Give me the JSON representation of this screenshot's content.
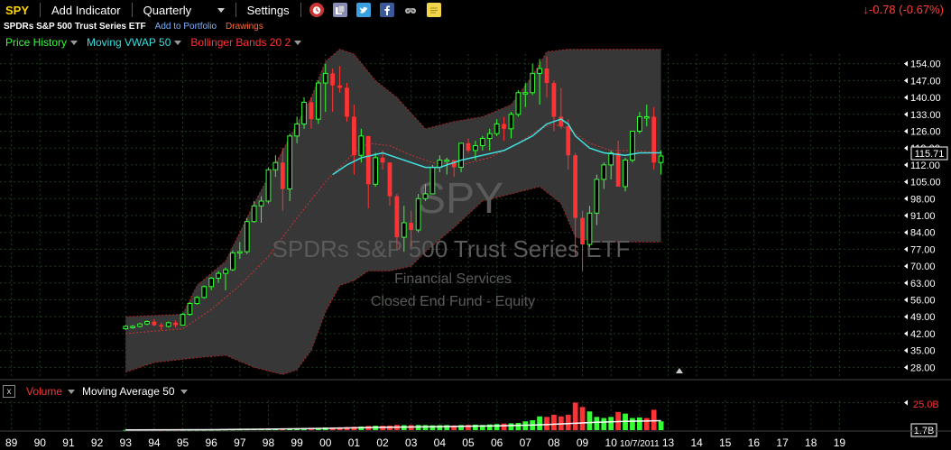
{
  "toolbar": {
    "ticker": "SPY",
    "add_indicator": "Add Indicator",
    "period": "Quarterly",
    "settings": "Settings",
    "change": "-0.78 (-0.67%)",
    "icons": [
      "alarm-icon",
      "copy-icon",
      "twitter-icon",
      "facebook-icon",
      "binoculars-icon",
      "notes-icon"
    ]
  },
  "subline": {
    "name": "SPDRs S&P 500 Trust Series ETF",
    "add_portfolio": "Add to Portfolio",
    "drawings": "Drawings"
  },
  "indicators": [
    {
      "label": "Price History",
      "color": "#33ff33"
    },
    {
      "label": "Moving VWAP 50",
      "color": "#33e0e0"
    },
    {
      "label": "Bollinger Bands 20 2",
      "color": "#ff3333"
    }
  ],
  "watermark": {
    "ticker": "SPY",
    "name": "SPDRs S&P 500 Trust Series ETF",
    "sector": "Financial Services",
    "type": "Closed End Fund - Equity"
  },
  "volume_panel": {
    "close": "x",
    "label": "Volume",
    "ma_label": "Moving Average 50",
    "yticks": [
      "25.0B"
    ],
    "last_label": "1.7B"
  },
  "colors": {
    "up": "#33ff33",
    "down": "#ff3333",
    "vwap": "#40e0e0",
    "band_fill": "#3a3a3a",
    "change": "#ff3b3b"
  },
  "chart_data": {
    "type": "candlestick",
    "period": "Quarterly",
    "price_axis": {
      "ticks": [
        28,
        35,
        42,
        49,
        56,
        63,
        70,
        77,
        84,
        91,
        98,
        105,
        112,
        119,
        126,
        133,
        140,
        147,
        154
      ],
      "ylim": [
        24,
        158
      ],
      "last_price": "115.71"
    },
    "x_axis": {
      "tick_labels": [
        "89",
        "90",
        "91",
        "92",
        "93",
        "94",
        "95",
        "96",
        "97",
        "98",
        "99",
        "00",
        "01",
        "02",
        "03",
        "04",
        "05",
        "06",
        "07",
        "08",
        "09",
        "10",
        "10/7/2011",
        "13",
        "14",
        "15",
        "16",
        "17",
        "18",
        "19"
      ],
      "xlim": [
        1988.6,
        2020.2
      ]
    },
    "candles": [
      [
        1993.0,
        44.0,
        45.5,
        43.5,
        45.0
      ],
      [
        1993.25,
        45.0,
        45.5,
        44.0,
        45.0
      ],
      [
        1993.5,
        45.0,
        46.5,
        44.5,
        46.0
      ],
      [
        1993.75,
        46.0,
        47.5,
        45.5,
        47.0
      ],
      [
        1994.0,
        47.0,
        48.0,
        45.0,
        45.5
      ],
      [
        1994.25,
        45.5,
        46.5,
        43.5,
        45.0
      ],
      [
        1994.5,
        45.0,
        47.0,
        44.5,
        46.5
      ],
      [
        1994.75,
        46.5,
        47.5,
        44.5,
        45.5
      ],
      [
        1995.0,
        45.5,
        50.5,
        45.5,
        50.0
      ],
      [
        1995.25,
        50.0,
        55.0,
        49.5,
        54.5
      ],
      [
        1995.5,
        54.5,
        57.5,
        54.0,
        57.0
      ],
      [
        1995.75,
        57.0,
        62.0,
        56.5,
        61.5
      ],
      [
        1996.0,
        61.5,
        65.5,
        60.0,
        65.0
      ],
      [
        1996.25,
        65.0,
        68.0,
        63.0,
        67.0
      ],
      [
        1996.5,
        67.0,
        69.5,
        60.0,
        68.5
      ],
      [
        1996.75,
        68.5,
        76.5,
        68.0,
        75.5
      ],
      [
        1997.0,
        75.5,
        80.0,
        73.0,
        76.0
      ],
      [
        1997.25,
        76.0,
        90.0,
        75.0,
        88.5
      ],
      [
        1997.5,
        88.5,
        97.0,
        88.0,
        95.0
      ],
      [
        1997.75,
        95.0,
        99.0,
        88.0,
        97.0
      ],
      [
        1998.0,
        97.0,
        111.0,
        96.0,
        110.0
      ],
      [
        1998.25,
        110.0,
        116.0,
        107.0,
        113.0
      ],
      [
        1998.5,
        113.0,
        119.0,
        93.0,
        102.0
      ],
      [
        1998.75,
        102.0,
        125.0,
        97.0,
        124.0
      ],
      [
        1999.0,
        124.0,
        132.0,
        121.0,
        129.0
      ],
      [
        1999.25,
        129.0,
        140.0,
        127.0,
        138.0
      ],
      [
        1999.5,
        138.0,
        140.0,
        127.0,
        131.0
      ],
      [
        1999.75,
        131.0,
        147.0,
        129.0,
        146.0
      ],
      [
        2000.0,
        146.0,
        154.0,
        134.0,
        150.0
      ],
      [
        2000.25,
        150.0,
        152.0,
        134.0,
        145.0
      ],
      [
        2000.5,
        145.0,
        153.0,
        142.0,
        144.0
      ],
      [
        2000.75,
        144.0,
        146.0,
        130.0,
        132.0
      ],
      [
        2001.0,
        132.0,
        137.0,
        108.0,
        116.0
      ],
      [
        2001.25,
        116.0,
        127.0,
        113.0,
        124.0
      ],
      [
        2001.5,
        124.0,
        124.0,
        94.0,
        104.0
      ],
      [
        2001.75,
        104.0,
        117.0,
        103.0,
        115.0
      ],
      [
        2002.0,
        115.0,
        118.0,
        110.0,
        113.0
      ],
      [
        2002.25,
        113.0,
        113.0,
        95.0,
        99.0
      ],
      [
        2002.5,
        99.0,
        100.0,
        77.0,
        82.0
      ],
      [
        2002.75,
        82.0,
        95.0,
        76.0,
        88.0
      ],
      [
        2003.0,
        88.0,
        93.0,
        78.0,
        85.0
      ],
      [
        2003.25,
        85.0,
        100.0,
        84.0,
        98.0
      ],
      [
        2003.5,
        98.0,
        104.0,
        97.0,
        100.0
      ],
      [
        2003.75,
        100.0,
        112.0,
        100.0,
        111.0
      ],
      [
        2004.0,
        111.0,
        116.0,
        109.0,
        114.0
      ],
      [
        2004.25,
        114.0,
        115.0,
        108.0,
        114.0
      ],
      [
        2004.5,
        114.0,
        114.0,
        107.0,
        111.0
      ],
      [
        2004.75,
        111.0,
        121.0,
        109.0,
        121.0
      ],
      [
        2005.0,
        121.0,
        123.0,
        117.0,
        118.0
      ],
      [
        2005.25,
        118.0,
        122.0,
        114.0,
        120.0
      ],
      [
        2005.5,
        120.0,
        124.0,
        118.0,
        123.0
      ],
      [
        2005.75,
        123.0,
        127.0,
        118.0,
        125.0
      ],
      [
        2006.0,
        125.0,
        131.0,
        124.0,
        129.0
      ],
      [
        2006.25,
        129.0,
        132.0,
        122.0,
        127.0
      ],
      [
        2006.5,
        127.0,
        134.0,
        123.0,
        133.0
      ],
      [
        2006.75,
        133.0,
        143.0,
        132.0,
        142.0
      ],
      [
        2007.0,
        142.0,
        146.0,
        136.0,
        142.0
      ],
      [
        2007.25,
        142.0,
        154.0,
        141.0,
        150.0
      ],
      [
        2007.5,
        150.0,
        156.0,
        137.0,
        152.0
      ],
      [
        2007.75,
        152.0,
        157.0,
        140.0,
        146.0
      ],
      [
        2008.0,
        146.0,
        147.0,
        126.0,
        132.0
      ],
      [
        2008.25,
        132.0,
        144.0,
        127.0,
        128.0
      ],
      [
        2008.5,
        128.0,
        131.0,
        110.0,
        116.0
      ],
      [
        2008.75,
        116.0,
        117.0,
        74.0,
        90.0
      ],
      [
        2009.0,
        90.0,
        93.0,
        68.0,
        79.0
      ],
      [
        2009.25,
        79.0,
        95.0,
        78.0,
        92.0
      ],
      [
        2009.5,
        92.0,
        108.0,
        87.0,
        106.0
      ],
      [
        2009.75,
        106.0,
        113.0,
        102.0,
        112.0
      ],
      [
        2010.0,
        112.0,
        118.0,
        106.0,
        117.0
      ],
      [
        2010.25,
        117.0,
        122.0,
        103.0,
        103.0
      ],
      [
        2010.5,
        103.0,
        115.0,
        101.0,
        114.0
      ],
      [
        2010.75,
        114.0,
        126.0,
        113.0,
        126.0
      ],
      [
        2011.0,
        126.0,
        134.0,
        125.0,
        132.0
      ],
      [
        2011.25,
        132.0,
        137.0,
        128.0,
        132.0
      ],
      [
        2011.5,
        132.0,
        136.0,
        110.0,
        113.0
      ],
      [
        2011.75,
        113.0,
        118.0,
        108.0,
        115.7
      ]
    ],
    "bollinger": {
      "upper": [
        [
          1993.0,
          49
        ],
        [
          1995.0,
          50
        ],
        [
          1995.5,
          62
        ],
        [
          1996.5,
          72
        ],
        [
          1997.5,
          96
        ],
        [
          1998.5,
          118
        ],
        [
          1999.5,
          140
        ],
        [
          2000.0,
          155
        ],
        [
          2000.5,
          160
        ],
        [
          2001.0,
          158
        ],
        [
          2001.75,
          147
        ],
        [
          2002.5,
          140
        ],
        [
          2003.5,
          127
        ],
        [
          2004.5,
          130
        ],
        [
          2005.5,
          132
        ],
        [
          2006.5,
          137
        ],
        [
          2007.25,
          149
        ],
        [
          2007.75,
          159
        ],
        [
          2008.5,
          160
        ],
        [
          2009.5,
          160
        ],
        [
          2010.5,
          160
        ],
        [
          2011.75,
          160
        ]
      ],
      "middle": [
        [
          1993.0,
          42
        ],
        [
          1995.0,
          44
        ],
        [
          1996.0,
          52
        ],
        [
          1997.0,
          62
        ],
        [
          1998.0,
          74
        ],
        [
          1999.0,
          90
        ],
        [
          2000.0,
          105
        ],
        [
          2001.0,
          117
        ],
        [
          2001.5,
          121
        ],
        [
          2002.25,
          120
        ],
        [
          2003.0,
          116
        ],
        [
          2003.75,
          113
        ],
        [
          2004.75,
          112
        ],
        [
          2005.75,
          115
        ],
        [
          2006.75,
          121
        ],
        [
          2007.5,
          127
        ],
        [
          2008.0,
          129
        ],
        [
          2008.5,
          127
        ],
        [
          2009.25,
          121
        ],
        [
          2010.0,
          118
        ],
        [
          2010.75,
          118
        ],
        [
          2011.75,
          117
        ]
      ],
      "lower": [
        [
          1993.0,
          26
        ],
        [
          1994.0,
          30
        ],
        [
          1995.5,
          32
        ],
        [
          1996.5,
          33
        ],
        [
          1997.5,
          28
        ],
        [
          1998.5,
          25
        ],
        [
          1999.0,
          27
        ],
        [
          1999.5,
          35
        ],
        [
          2000.0,
          51
        ],
        [
          2000.5,
          62
        ],
        [
          2001.0,
          64
        ],
        [
          2001.5,
          68
        ],
        [
          2002.25,
          68
        ],
        [
          2003.0,
          70
        ],
        [
          2003.5,
          76
        ],
        [
          2004.5,
          86
        ],
        [
          2005.5,
          97
        ],
        [
          2006.5,
          100
        ],
        [
          2007.5,
          103
        ],
        [
          2008.25,
          96
        ],
        [
          2008.75,
          82
        ],
        [
          2009.5,
          80
        ],
        [
          2010.5,
          80
        ],
        [
          2011.75,
          80
        ]
      ]
    },
    "vwap": [
      [
        2000.25,
        108
      ],
      [
        2000.75,
        112
      ],
      [
        2001.25,
        115
      ],
      [
        2002.0,
        117
      ],
      [
        2002.75,
        114
      ],
      [
        2003.5,
        111
      ],
      [
        2004.0,
        111
      ],
      [
        2004.75,
        114
      ],
      [
        2005.5,
        116
      ],
      [
        2006.25,
        118
      ],
      [
        2006.75,
        121
      ],
      [
        2007.25,
        124
      ],
      [
        2007.75,
        129
      ],
      [
        2008.25,
        131
      ],
      [
        2008.5,
        129
      ],
      [
        2008.75,
        124
      ],
      [
        2009.25,
        119
      ],
      [
        2009.75,
        117
      ],
      [
        2010.5,
        116
      ],
      [
        2011.0,
        117
      ],
      [
        2011.75,
        117
      ]
    ],
    "volume": [
      [
        1993.0,
        0.2,
        1
      ],
      [
        1993.25,
        0.2,
        0
      ],
      [
        1993.5,
        0.2,
        1
      ],
      [
        1993.75,
        0.2,
        1
      ],
      [
        1994.0,
        0.3,
        0
      ],
      [
        1994.25,
        0.3,
        0
      ],
      [
        1994.5,
        0.3,
        1
      ],
      [
        1994.75,
        0.3,
        0
      ],
      [
        1995.0,
        0.3,
        1
      ],
      [
        1995.25,
        0.3,
        1
      ],
      [
        1995.5,
        0.3,
        1
      ],
      [
        1995.75,
        0.4,
        1
      ],
      [
        1996.0,
        0.5,
        1
      ],
      [
        1996.25,
        0.5,
        1
      ],
      [
        1996.5,
        0.6,
        1
      ],
      [
        1996.75,
        0.6,
        1
      ],
      [
        1997.0,
        0.7,
        1
      ],
      [
        1997.25,
        0.8,
        1
      ],
      [
        1997.5,
        0.9,
        1
      ],
      [
        1997.75,
        1.0,
        1
      ],
      [
        1998.0,
        1.2,
        1
      ],
      [
        1998.25,
        1.3,
        1
      ],
      [
        1998.5,
        1.5,
        0
      ],
      [
        1998.75,
        1.5,
        1
      ],
      [
        1999.0,
        1.6,
        1
      ],
      [
        1999.25,
        1.8,
        1
      ],
      [
        1999.5,
        2.0,
        0
      ],
      [
        1999.75,
        2.1,
        1
      ],
      [
        2000.0,
        2.4,
        1
      ],
      [
        2000.25,
        2.5,
        0
      ],
      [
        2000.5,
        2.6,
        0
      ],
      [
        2000.75,
        2.8,
        0
      ],
      [
        2001.0,
        3.1,
        0
      ],
      [
        2001.25,
        3.3,
        1
      ],
      [
        2001.5,
        3.8,
        0
      ],
      [
        2001.75,
        4.0,
        1
      ],
      [
        2002.0,
        4.0,
        0
      ],
      [
        2002.25,
        4.2,
        0
      ],
      [
        2002.5,
        4.8,
        0
      ],
      [
        2002.75,
        4.5,
        1
      ],
      [
        2003.0,
        4.6,
        0
      ],
      [
        2003.25,
        4.7,
        1
      ],
      [
        2003.5,
        4.6,
        1
      ],
      [
        2003.75,
        4.4,
        1
      ],
      [
        2004.0,
        4.5,
        1
      ],
      [
        2004.25,
        4.6,
        1
      ],
      [
        2004.5,
        4.3,
        0
      ],
      [
        2004.75,
        4.6,
        1
      ],
      [
        2005.0,
        4.8,
        0
      ],
      [
        2005.25,
        5.0,
        1
      ],
      [
        2005.5,
        4.7,
        1
      ],
      [
        2005.75,
        5.2,
        1
      ],
      [
        2006.0,
        5.5,
        1
      ],
      [
        2006.25,
        6.0,
        0
      ],
      [
        2006.5,
        6.2,
        1
      ],
      [
        2006.75,
        6.5,
        1
      ],
      [
        2007.0,
        8.0,
        1
      ],
      [
        2007.25,
        9.0,
        1
      ],
      [
        2007.5,
        12.5,
        1
      ],
      [
        2007.75,
        12.0,
        0
      ],
      [
        2008.0,
        14.0,
        0
      ],
      [
        2008.25,
        12.5,
        0
      ],
      [
        2008.5,
        14.0,
        0
      ],
      [
        2008.75,
        25.0,
        0
      ],
      [
        2009.0,
        21.0,
        0
      ],
      [
        2009.25,
        17.0,
        1
      ],
      [
        2009.5,
        12.0,
        1
      ],
      [
        2009.75,
        11.0,
        1
      ],
      [
        2010.0,
        12.0,
        1
      ],
      [
        2010.25,
        16.5,
        0
      ],
      [
        2010.5,
        15.0,
        1
      ],
      [
        2010.75,
        11.0,
        1
      ],
      [
        2011.0,
        11.5,
        1
      ],
      [
        2011.25,
        11.0,
        0
      ],
      [
        2011.5,
        18.5,
        0
      ],
      [
        2011.75,
        8.0,
        1
      ]
    ],
    "volume_ma": [
      [
        1993.0,
        0.2
      ],
      [
        1996.0,
        0.4
      ],
      [
        1998.0,
        0.9
      ],
      [
        2000.0,
        1.6
      ],
      [
        2002.0,
        2.5
      ],
      [
        2004.0,
        3.2
      ],
      [
        2006.0,
        3.9
      ],
      [
        2007.5,
        4.8
      ],
      [
        2008.5,
        6.0
      ],
      [
        2009.5,
        7.2
      ],
      [
        2010.5,
        8.0
      ],
      [
        2011.75,
        8.6
      ]
    ],
    "volume_ylim": [
      0,
      27
    ]
  }
}
